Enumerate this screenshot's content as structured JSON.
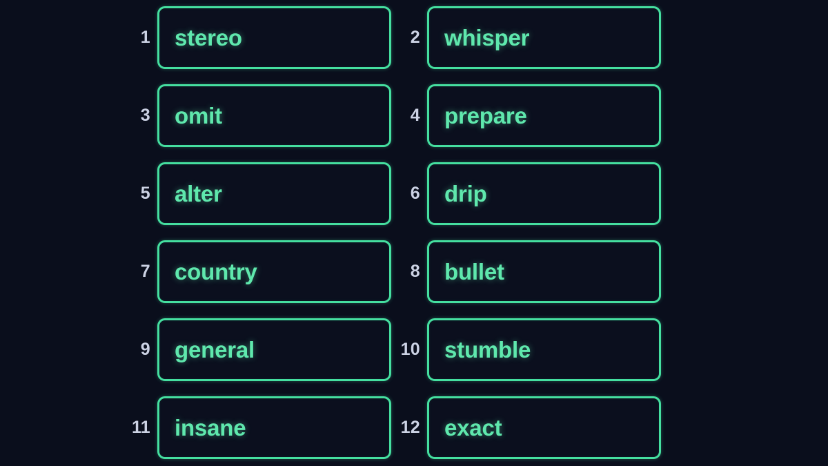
{
  "theme": {
    "background_color": "#0a0e1c",
    "box_border_color": "#45dfa0",
    "box_fill_color": "#0b0f1e",
    "word_text_color": "#5fe8ad",
    "index_text_color": "#ccd2e4"
  },
  "layout": {
    "columns": 2,
    "rows": 6,
    "total_items": 12
  },
  "words": [
    {
      "index": "1",
      "word": "stereo"
    },
    {
      "index": "2",
      "word": "whisper"
    },
    {
      "index": "3",
      "word": "omit"
    },
    {
      "index": "4",
      "word": "prepare"
    },
    {
      "index": "5",
      "word": "alter"
    },
    {
      "index": "6",
      "word": "drip"
    },
    {
      "index": "7",
      "word": "country"
    },
    {
      "index": "8",
      "word": "bullet"
    },
    {
      "index": "9",
      "word": "general"
    },
    {
      "index": "10",
      "word": "stumble"
    },
    {
      "index": "11",
      "word": "insane"
    },
    {
      "index": "12",
      "word": "exact"
    }
  ]
}
